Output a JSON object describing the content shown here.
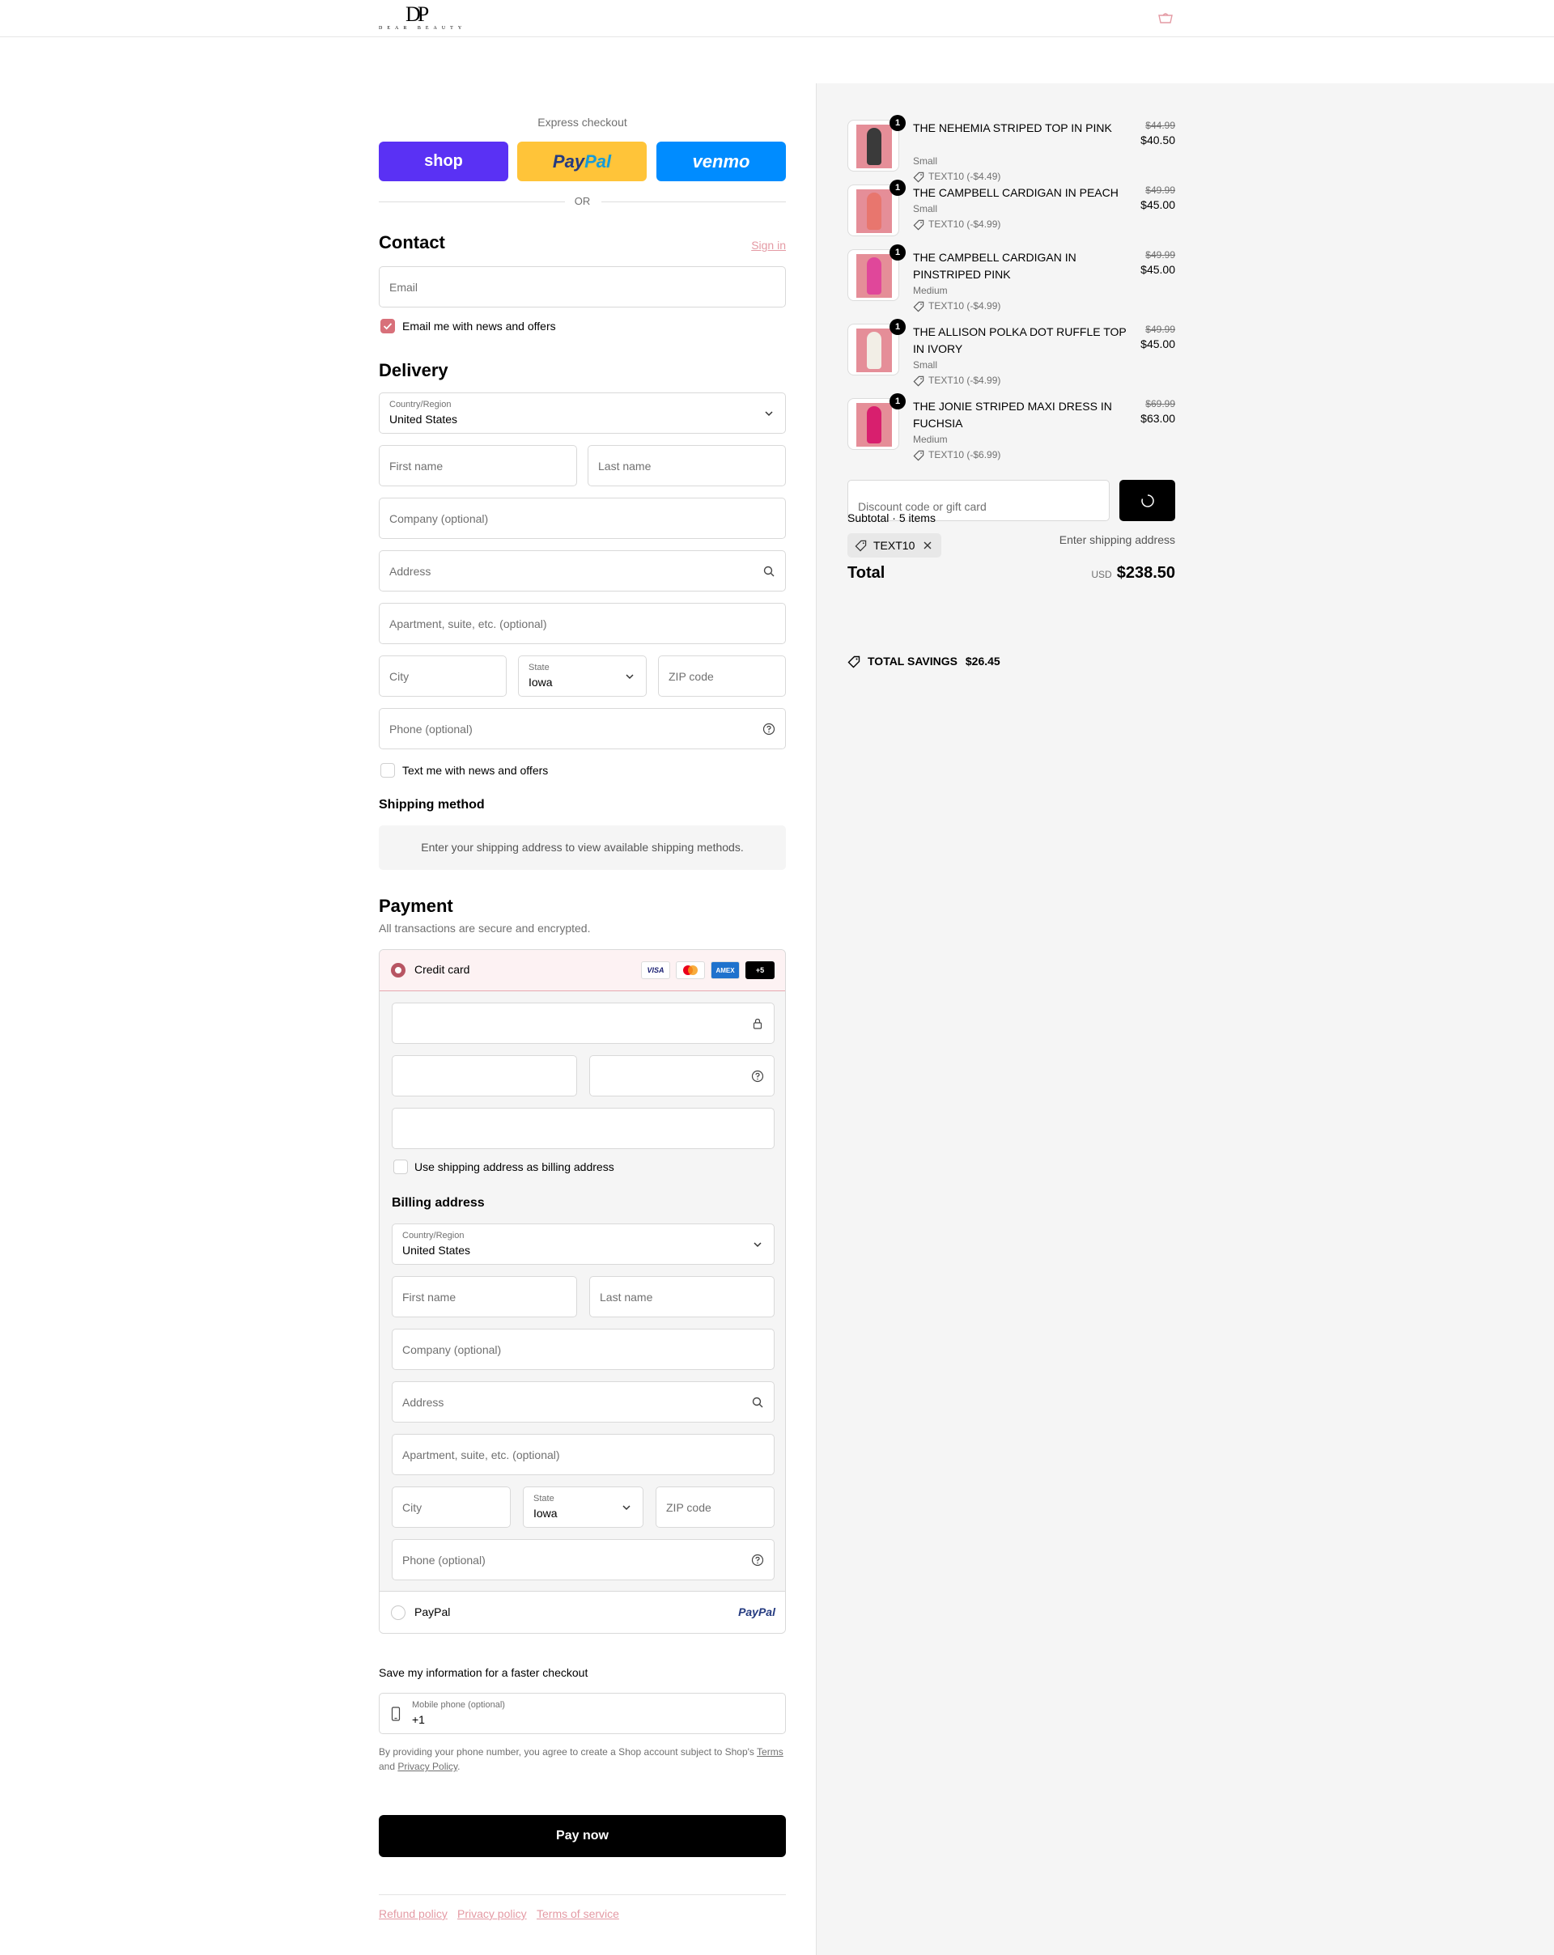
{
  "header": {
    "logo_monogram": "DP",
    "logo_wordmark": "DEAR BEAUTY",
    "cart_icon": "bag-icon"
  },
  "express": {
    "label": "Express checkout",
    "shop_label": "shop",
    "paypal_label_a": "Pay",
    "paypal_label_b": "Pal",
    "venmo_label": "venmo",
    "or_label": "OR"
  },
  "contact": {
    "title": "Contact",
    "sign_in": "Sign in",
    "email_placeholder": "Email",
    "news_label": "Email me with news and offers",
    "news_checked": true
  },
  "delivery": {
    "title": "Delivery",
    "country_label": "Country/Region",
    "country_value": "United States",
    "first_name": "First name",
    "last_name": "Last name",
    "company": "Company (optional)",
    "address": "Address",
    "apartment": "Apartment, suite, etc. (optional)",
    "city": "City",
    "state_label": "State",
    "state_value": "Iowa",
    "zip": "ZIP code",
    "phone": "Phone (optional)",
    "text_label": "Text me with news and offers"
  },
  "shipping": {
    "title": "Shipping method",
    "notice": "Enter your shipping address to view available shipping methods."
  },
  "payment": {
    "title": "Payment",
    "subtitle": "All transactions are secure and encrypted.",
    "credit_card_label": "Credit card",
    "card_logos": [
      "VISA",
      "mastercard",
      "AMEX",
      "+5"
    ],
    "billing_same_label": "Use shipping address as billing address",
    "billing_title": "Billing address",
    "billing": {
      "country_label": "Country/Region",
      "country_value": "United States",
      "first_name": "First name",
      "last_name": "Last name",
      "company": "Company (optional)",
      "address": "Address",
      "apartment": "Apartment, suite, etc. (optional)",
      "city": "City",
      "state_label": "State",
      "state_value": "Iowa",
      "zip": "ZIP code",
      "phone": "Phone (optional)"
    },
    "paypal_label": "PayPal",
    "paypal_logo": "PayPal"
  },
  "save_info": {
    "title": "Save my information for a faster checkout",
    "mobile_label": "Mobile phone (optional)",
    "mobile_value": "+1",
    "legal_a": "By providing your phone number, you agree to create a Shop account subject to Shop's ",
    "legal_terms": "Terms",
    "legal_b": "and ",
    "legal_privacy": "Privacy Policy",
    "legal_end": "."
  },
  "pay_now": "Pay now",
  "footer": {
    "refund": "Refund policy",
    "privacy": "Privacy policy",
    "terms": "Terms of service"
  },
  "summary": {
    "items": [
      {
        "qty": "1",
        "name": "THE NEHEMIA STRIPED TOP IN PINK",
        "variant": "Small",
        "discount": "TEXT10 (-$4.49)",
        "old_price": "$44.99",
        "price": "$40.50",
        "color": "#3a3a3a"
      },
      {
        "qty": "1",
        "name": "THE CAMPBELL CARDIGAN IN PEACH",
        "variant": "Small",
        "discount": "TEXT10 (-$4.99)",
        "old_price": "$49.99",
        "price": "$45.00",
        "color": "#e8766e"
      },
      {
        "qty": "1",
        "name": "THE CAMPBELL CARDIGAN IN PINSTRIPED PINK",
        "variant": "Medium",
        "discount": "TEXT10 (-$4.99)",
        "old_price": "$49.99",
        "price": "$45.00",
        "color": "#e0479a"
      },
      {
        "qty": "1",
        "name": "THE ALLISON POLKA DOT RUFFLE TOP IN IVORY",
        "variant": "Small",
        "discount": "TEXT10 (-$4.99)",
        "old_price": "$49.99",
        "price": "$45.00",
        "color": "#f2eee6"
      },
      {
        "qty": "1",
        "name": "THE JONIE STRIPED MAXI DRESS IN FUCHSIA",
        "variant": "Medium",
        "discount": "TEXT10 (-$6.99)",
        "old_price": "$69.99",
        "price": "$63.00",
        "color": "#d81f6e"
      }
    ],
    "discount_placeholder": "Discount code or gift card",
    "subtotal_label": "Subtotal · 5 items",
    "code_chip": "TEXT10",
    "shipping_label": "Enter shipping address",
    "total_label": "Total",
    "currency": "USD",
    "total_value": "$238.50",
    "savings_label": "TOTAL SAVINGS",
    "savings_value": "$26.45"
  }
}
